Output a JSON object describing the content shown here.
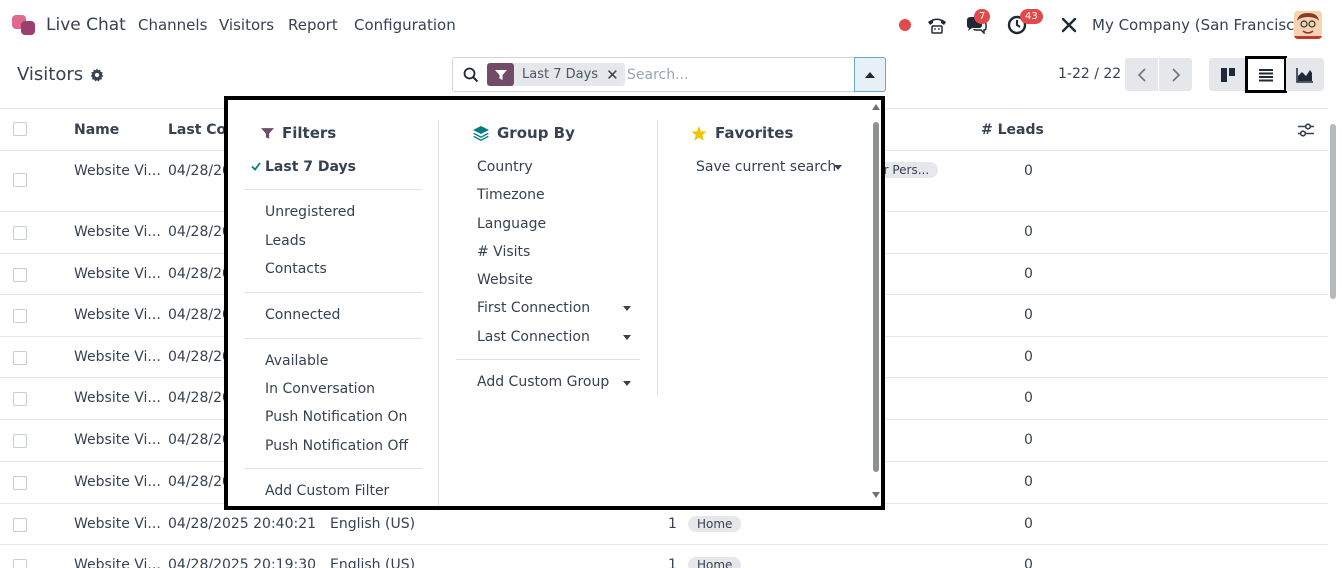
{
  "topnav": {
    "app_name": "Live Chat",
    "menu": [
      "Channels",
      "Visitors",
      "Report",
      "Configuration"
    ],
    "chat_badge": "7",
    "activity_badge": "43",
    "company": "My Company (San Francisco)"
  },
  "control_panel": {
    "title": "Visitors",
    "facet_label": "Last 7 Days",
    "search_placeholder": "Search...",
    "pager": "1-22 / 22"
  },
  "table": {
    "headers": {
      "name": "Name",
      "last_connection": "Last Con",
      "leads": "# Leads"
    },
    "rows": [
      {
        "name": "Website Vi...",
        "date": "04/28/20",
        "lang": "",
        "visits": "",
        "page": "ur Pers...",
        "leads": "0"
      },
      {
        "name": "Website Vi...",
        "date": "04/28/20",
        "lang": "",
        "visits": "",
        "page": "",
        "leads": "0"
      },
      {
        "name": "Website Vi...",
        "date": "04/28/20",
        "lang": "",
        "visits": "",
        "page": "",
        "leads": "0"
      },
      {
        "name": "Website Vi...",
        "date": "04/28/20",
        "lang": "",
        "visits": "",
        "page": "",
        "leads": "0"
      },
      {
        "name": "Website Vi...",
        "date": "04/28/20",
        "lang": "",
        "visits": "",
        "page": "",
        "leads": "0"
      },
      {
        "name": "Website Vi...",
        "date": "04/28/20",
        "lang": "",
        "visits": "",
        "page": "",
        "leads": "0"
      },
      {
        "name": "Website Vi...",
        "date": "04/28/20",
        "lang": "",
        "visits": "",
        "page": "",
        "leads": "0"
      },
      {
        "name": "Website Vi...",
        "date": "04/28/20",
        "lang": "",
        "visits": "",
        "page": "",
        "leads": "0"
      },
      {
        "name": "Website Vi...",
        "date": "04/28/2025 20:40:21",
        "lang": "English (US)",
        "visits": "1",
        "page": "Home",
        "leads": "0"
      },
      {
        "name": "Website Vi...",
        "date": "04/28/2025 20:19:30",
        "lang": "English (US)",
        "visits": "1",
        "page": "Home",
        "leads": "0"
      }
    ]
  },
  "dropdown": {
    "filters": {
      "title": "Filters",
      "items": [
        "Last 7 Days",
        "Unregistered",
        "Leads",
        "Contacts",
        "Connected",
        "Available",
        "In Conversation",
        "Push Notification On",
        "Push Notification Off",
        "Add Custom Filter"
      ]
    },
    "group_by": {
      "title": "Group By",
      "items": [
        "Country",
        "Timezone",
        "Language",
        "# Visits",
        "Website",
        "First Connection",
        "Last Connection",
        "Add Custom Group"
      ]
    },
    "favorites": {
      "title": "Favorites",
      "items": [
        "Save current search"
      ]
    }
  },
  "colors": {
    "brand": "#714b67",
    "badge": "#e04a4a",
    "star": "#f3c300",
    "group_icon": "#017e84"
  },
  "icons": [
    "app-logo",
    "record-dot-icon",
    "phone-icon",
    "chat-icon",
    "clock-icon",
    "tools-icon",
    "gear-icon",
    "search-icon",
    "filter-icon",
    "close-icon",
    "caret-up-icon",
    "chevron-left-icon",
    "chevron-right-icon",
    "kanban-view-icon",
    "list-view-icon",
    "graph-view-icon",
    "column-settings-icon",
    "check-icon",
    "layers-icon",
    "star-icon",
    "caret-down-icon"
  ]
}
